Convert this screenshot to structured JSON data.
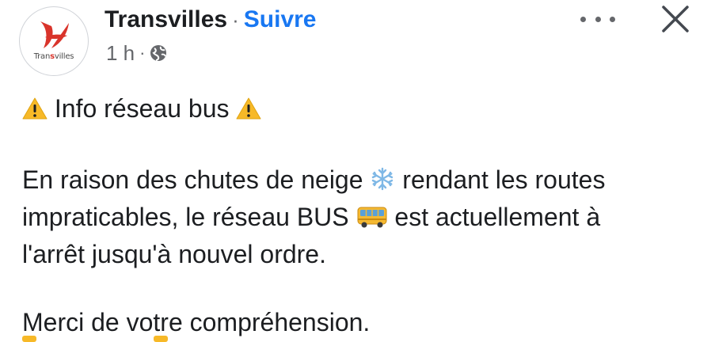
{
  "post_header": {
    "page_name": "Transvilles",
    "separator": "·",
    "follow_label": "Suivre",
    "time": "1 h",
    "meta_separator": "·",
    "audience_icon": "globe-icon"
  },
  "avatar": {
    "brand_prefix": "Tran",
    "brand_mid": "s",
    "brand_suffix": "villes",
    "brand_color": "#d9342b"
  },
  "actions": {
    "more_icon": "more-options-icon",
    "close_icon": "close-icon"
  },
  "post": {
    "title": "Info réseau bus",
    "title_icons": [
      "warning-icon",
      "warning-icon"
    ],
    "line1_a": "En raison des chutes de neige ",
    "line1_b": " rendant les routes",
    "line2_a": "impraticables, le réseau BUS ",
    "line2_b": " est actuellement à",
    "line3": "l'arrêt jusqu'à nouvel ordre.",
    "thanks": "Merci de votre compréhension.",
    "inline_icons": [
      "snowflake-icon",
      "bus-icon"
    ]
  },
  "colors": {
    "link": "#1877f2",
    "secondary_text": "#65676b",
    "primary_text": "#1c1e21",
    "warning": "#f7b928"
  }
}
